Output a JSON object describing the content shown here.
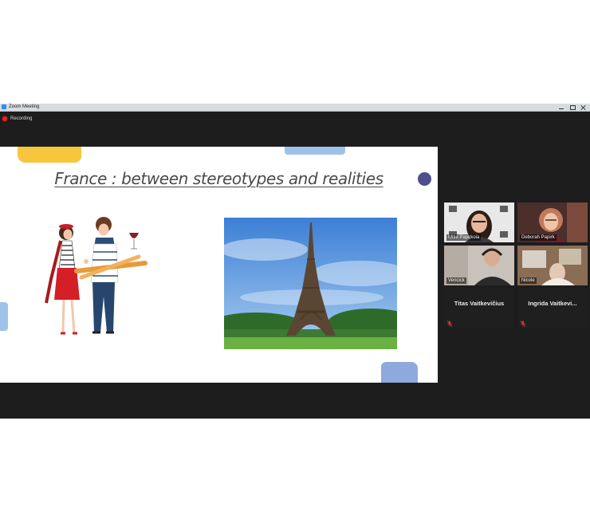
{
  "window": {
    "title": "Zoom Meeting"
  },
  "recording": {
    "label": "Recording"
  },
  "slide": {
    "title": "France : between stereotypes and realities"
  },
  "participants": [
    {
      "name": "Mitie  Papirkola",
      "video": true,
      "active_speaker": true
    },
    {
      "name": "Deborah  Papirk",
      "video": true
    },
    {
      "name": "Vencick",
      "video": true
    },
    {
      "name": "Nicole",
      "video": true
    },
    {
      "name": "Titas Vaitkevičius",
      "video": false,
      "muted": true
    },
    {
      "name": "Ingrida Vaitkevi...",
      "video": false,
      "muted": true
    }
  ],
  "colors": {
    "window_bg": "#1d1d1d",
    "recording_dot": "#e02828",
    "active_speaker_border": "#b4e04a",
    "slide_yellow": "#f7c63c",
    "slide_blue": "#9ec3ea",
    "slide_dot": "#4d4e8f"
  }
}
